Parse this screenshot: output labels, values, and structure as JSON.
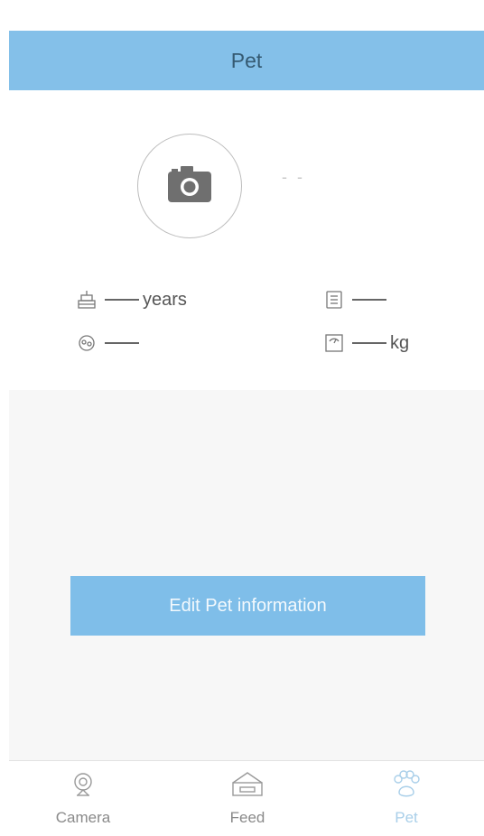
{
  "header": {
    "title": "Pet"
  },
  "profile": {
    "name": "- -",
    "age_unit": "years",
    "weight_unit": "kg",
    "icons": [
      "birthday-cake-icon",
      "id-card-icon",
      "gender-icon",
      "scale-icon",
      "camera-icon"
    ]
  },
  "actions": {
    "edit_label": "Edit Pet information"
  },
  "tabs": [
    {
      "label": "Camera",
      "icon": "webcam-icon",
      "active": false
    },
    {
      "label": "Feed",
      "icon": "food-bowl-icon",
      "active": false
    },
    {
      "label": "Pet",
      "icon": "paw-icon",
      "active": true
    }
  ],
  "colors": {
    "accent": "#84c0e9",
    "button": "#7fbee9",
    "active_tab": "#a9cfe9"
  }
}
